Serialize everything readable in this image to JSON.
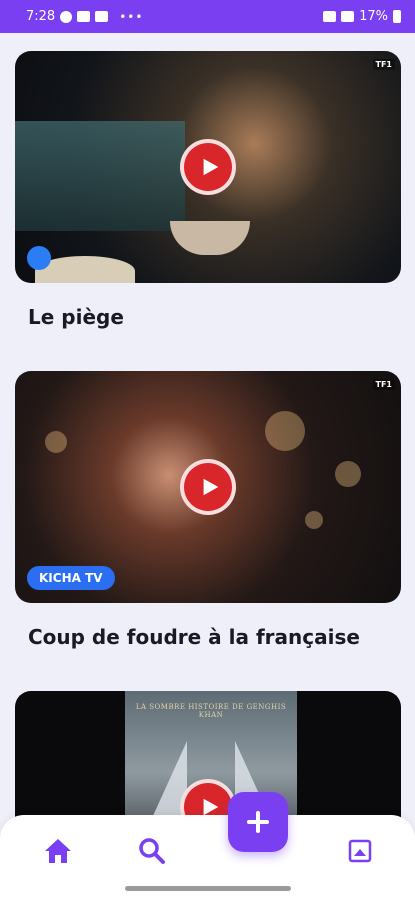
{
  "status_bar": {
    "time": "7:28",
    "battery": "17%"
  },
  "videos": [
    {
      "title": "Le piège",
      "channel_logo": "TF1"
    },
    {
      "title": "Coup de foudre à la française",
      "channel_logo": "TF1",
      "badge": "KICHA TV"
    },
    {
      "title": "",
      "poster_text": "LA SOMBRE HISTOIRE DE GENGHIS KHAN"
    }
  ],
  "nav": {
    "items": [
      "home-icon",
      "search-icon",
      "add-icon",
      "gallery-icon"
    ],
    "accent": "#7b3ff2"
  }
}
